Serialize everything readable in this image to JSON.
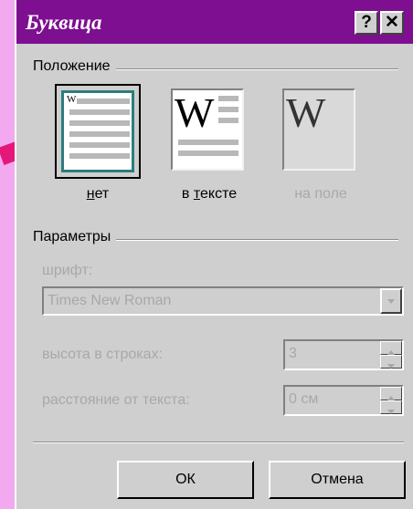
{
  "dialog": {
    "title": "Буквица",
    "help_label": "?",
    "close_label": "✕"
  },
  "position_group": {
    "label": "Положение",
    "options": [
      {
        "label_pre": "",
        "label_u": "н",
        "label_post": "ет",
        "selected": true,
        "enabled": true,
        "sample_letter": "W"
      },
      {
        "label_pre": "в ",
        "label_u": "т",
        "label_post": "ексте",
        "selected": false,
        "enabled": true,
        "sample_letter": "W"
      },
      {
        "label_pre": "",
        "label_u": "",
        "label_post": "на поле",
        "selected": false,
        "enabled": false,
        "sample_letter": "W"
      }
    ]
  },
  "params_group": {
    "label": "Параметры",
    "font_label": "шрифт:",
    "font_value": "Times New Roman",
    "height_label": "высота в строках:",
    "height_value": "3",
    "distance_label": "расстояние от текста:",
    "distance_value": "0 см"
  },
  "buttons": {
    "ok_label": "ОК",
    "cancel_label": "Отмена"
  },
  "colors": {
    "background": "#f2a9f0",
    "titlebar": "#7d0f90",
    "dialog": "#cfcfcf",
    "arrow": "#e5187a",
    "selection": "#2d7d7d"
  }
}
